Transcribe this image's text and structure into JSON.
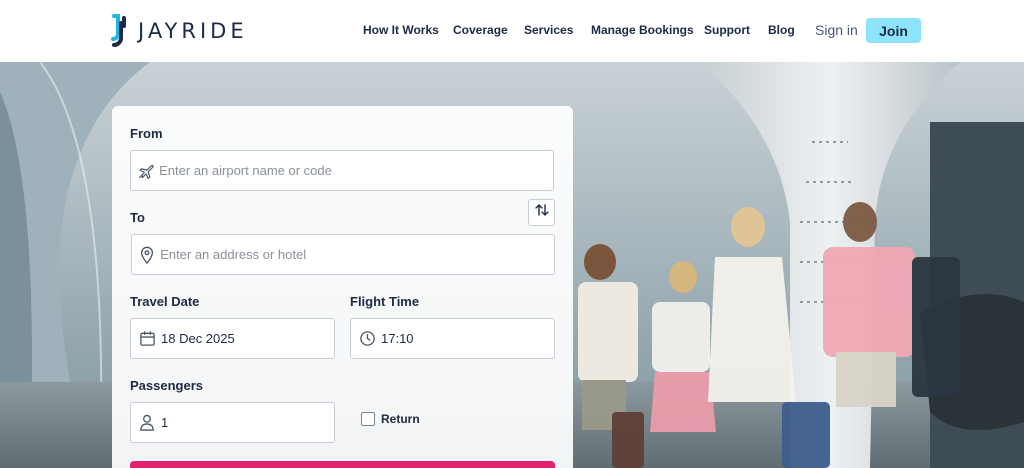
{
  "brand": {
    "name": "JAYRIDE"
  },
  "nav": {
    "items": [
      {
        "label": "How It Works"
      },
      {
        "label": "Coverage"
      },
      {
        "label": "Services"
      },
      {
        "label": "Manage Bookings"
      },
      {
        "label": "Support"
      },
      {
        "label": "Blog"
      }
    ],
    "signin": "Sign in",
    "join": "Join"
  },
  "form": {
    "from": {
      "label": "From",
      "placeholder": "Enter an airport name or code",
      "icon": "plane-icon"
    },
    "to": {
      "label": "To",
      "placeholder": "Enter an address or hotel",
      "icon": "map-pin-icon"
    },
    "swap_icon": "swap-arrows-icon",
    "travel_date": {
      "label": "Travel Date",
      "value": "18 Dec 2025",
      "icon": "calendar-icon"
    },
    "flight_time": {
      "label": "Flight Time",
      "value": "17:10",
      "icon": "clock-icon"
    },
    "passengers": {
      "label": "Passengers",
      "value": "1",
      "icon": "person-icon"
    },
    "return": {
      "label": "Return",
      "checked": false
    }
  },
  "colors": {
    "navy": "#1d2a44",
    "join_bg": "#8ce3fb",
    "search_btn": "#e2226d",
    "logo_cyan": "#1fb6e6"
  }
}
